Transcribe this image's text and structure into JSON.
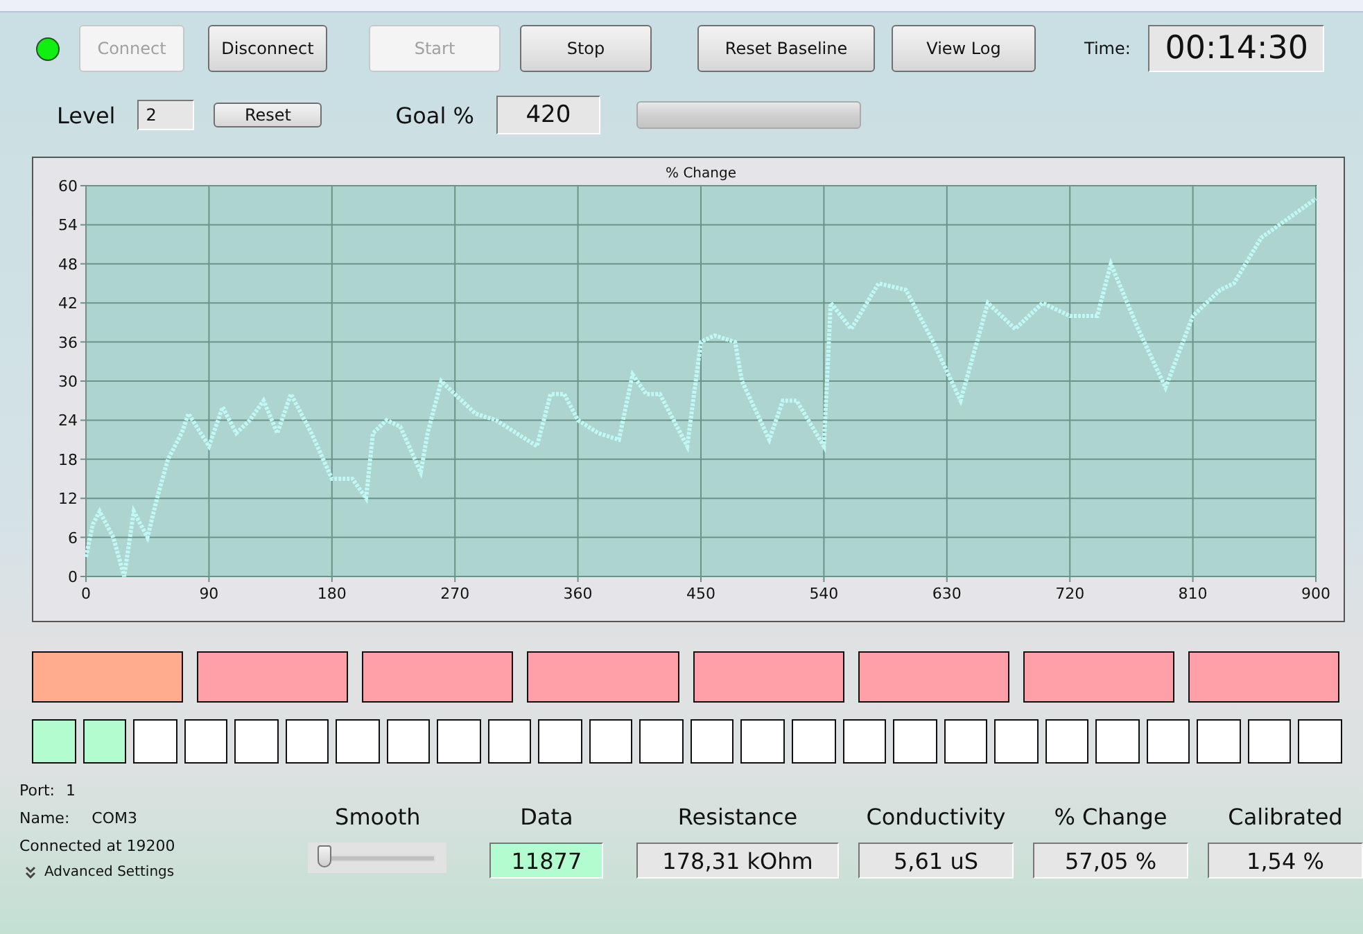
{
  "status_light": {
    "on": true
  },
  "top_buttons": [
    {
      "label": "Connect",
      "disabled": true
    },
    {
      "label": "Disconnect",
      "disabled": false
    },
    {
      "label": "Start",
      "disabled": true
    },
    {
      "label": "Stop",
      "disabled": false
    },
    {
      "label": "Reset Baseline",
      "disabled": false
    },
    {
      "label": "View Log",
      "disabled": false
    }
  ],
  "time": {
    "label": "Time:",
    "value": "00:14:30"
  },
  "level": {
    "label": "Level",
    "value": "2",
    "button": "Reset"
  },
  "goal": {
    "label": "Goal %",
    "value": "420"
  },
  "progress": {
    "level": 0
  },
  "chart": {
    "chart_data": {
      "type": "line",
      "title": "% Change",
      "x": [
        0,
        5,
        10,
        20,
        28,
        35,
        45,
        52,
        60,
        70,
        75,
        90,
        100,
        110,
        120,
        130,
        140,
        150,
        165,
        180,
        195,
        205,
        210,
        220,
        230,
        245,
        250,
        260,
        270,
        285,
        300,
        315,
        330,
        340,
        350,
        360,
        375,
        390,
        400,
        410,
        420,
        440,
        450,
        460,
        475,
        480,
        500,
        510,
        520,
        540,
        545,
        560,
        580,
        600,
        620,
        640,
        660,
        680,
        700,
        720,
        740,
        750,
        770,
        790,
        810,
        830,
        840,
        860,
        880,
        900
      ],
      "grid": true,
      "series": [
        {
          "color": "#bff8f4",
          "line_style": "dotted",
          "values": [
            3,
            8,
            10,
            6,
            0,
            10,
            6,
            12,
            18,
            22,
            25,
            20,
            26,
            22,
            24,
            27,
            22,
            28,
            22,
            15,
            15,
            12,
            22,
            24,
            23,
            16,
            22,
            30,
            28,
            25,
            24,
            22,
            20,
            28,
            28,
            24,
            22,
            21,
            31,
            28,
            28,
            20,
            36,
            37,
            36,
            30,
            21,
            27,
            27,
            20,
            42,
            38,
            45,
            44,
            36,
            27,
            42,
            38,
            42,
            40,
            40,
            48,
            38,
            29,
            40,
            44,
            45,
            52,
            55,
            58
          ]
        }
      ],
      "xlim": [
        0,
        900
      ],
      "ylim": [
        0,
        60
      ],
      "xticks": [
        0,
        90,
        180,
        270,
        360,
        450,
        540,
        630,
        720,
        810,
        900
      ],
      "yticks": [
        0,
        6,
        12,
        18,
        24,
        30,
        36,
        42,
        48,
        54,
        60
      ]
    }
  },
  "segments": [
    {
      "color": "#ffab8d"
    },
    {
      "color": "#ffa0a8"
    },
    {
      "color": "#ffa0a8"
    },
    {
      "color": "#ffa0a8"
    },
    {
      "color": "#ffa0a8"
    },
    {
      "color": "#ffa0a8"
    },
    {
      "color": "#ffa0a8"
    },
    {
      "color": "#ffa0a8"
    }
  ],
  "cells": [
    {
      "color": "#b3fcd0"
    },
    {
      "color": "#b3fcd0"
    },
    {
      "color": "#ffffff"
    },
    {
      "color": "#ffffff"
    },
    {
      "color": "#ffffff"
    },
    {
      "color": "#ffffff"
    },
    {
      "color": "#ffffff"
    },
    {
      "color": "#ffffff"
    },
    {
      "color": "#ffffff"
    },
    {
      "color": "#ffffff"
    },
    {
      "color": "#ffffff"
    },
    {
      "color": "#ffffff"
    },
    {
      "color": "#ffffff"
    },
    {
      "color": "#ffffff"
    },
    {
      "color": "#ffffff"
    },
    {
      "color": "#ffffff"
    },
    {
      "color": "#ffffff"
    },
    {
      "color": "#ffffff"
    },
    {
      "color": "#ffffff"
    },
    {
      "color": "#ffffff"
    },
    {
      "color": "#ffffff"
    },
    {
      "color": "#ffffff"
    },
    {
      "color": "#ffffff"
    },
    {
      "color": "#ffffff"
    },
    {
      "color": "#ffffff"
    },
    {
      "color": "#ffffff"
    }
  ],
  "connection": {
    "port_label": "Port:",
    "port": "1",
    "name_label": "Name:",
    "name": "COM3",
    "status": "Connected at 19200",
    "advanced": "Advanced Settings"
  },
  "smooth": {
    "label": "Smooth",
    "level": 0.05
  },
  "readouts": [
    {
      "label": "Data",
      "value": "11877",
      "highlight": true
    },
    {
      "label": "Resistance",
      "value": "178,31 kOhm",
      "highlight": false
    },
    {
      "label": "Conductivity",
      "value": "5,61 uS",
      "highlight": false
    },
    {
      "label": "% Change",
      "value": "57,05 %",
      "highlight": false
    },
    {
      "label": "Calibrated",
      "value": "1,54 %",
      "highlight": false
    }
  ]
}
